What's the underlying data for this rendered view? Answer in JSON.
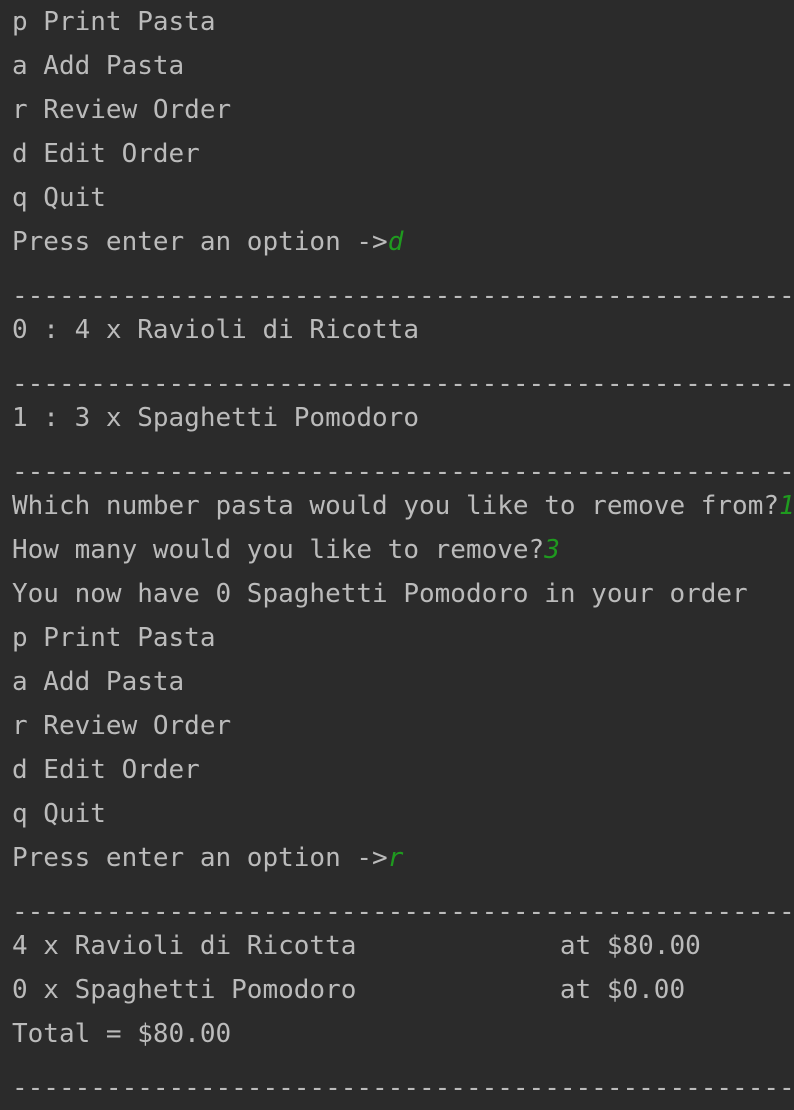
{
  "colors": {
    "background": "#2b2b2b",
    "text": "#bbbbbb",
    "user_input": "#1f9a1f"
  },
  "separator": "------------------------------------------------------------",
  "lines": [
    {
      "type": "text",
      "text": "p Print Pasta"
    },
    {
      "type": "text",
      "text": "a Add Pasta"
    },
    {
      "type": "text",
      "text": "r Review Order"
    },
    {
      "type": "text",
      "text": "d Edit Order"
    },
    {
      "type": "text",
      "text": "q Quit"
    },
    {
      "type": "prompt",
      "text": "Press enter an option ->",
      "input": "d"
    },
    {
      "type": "separator"
    },
    {
      "type": "text",
      "text": "0 : 4 x Ravioli di Ricotta"
    },
    {
      "type": "separator"
    },
    {
      "type": "text",
      "text": "1 : 3 x Spaghetti Pomodoro"
    },
    {
      "type": "separator"
    },
    {
      "type": "prompt",
      "text": "Which number pasta would you like to remove from?",
      "input": "1"
    },
    {
      "type": "prompt",
      "text": "How many would you like to remove?",
      "input": "3"
    },
    {
      "type": "text",
      "text": "You now have 0 Spaghetti Pomodoro in your order"
    },
    {
      "type": "text",
      "text": "p Print Pasta"
    },
    {
      "type": "text",
      "text": "a Add Pasta"
    },
    {
      "type": "text",
      "text": "r Review Order"
    },
    {
      "type": "text",
      "text": "d Edit Order"
    },
    {
      "type": "text",
      "text": "q Quit"
    },
    {
      "type": "prompt",
      "text": "Press enter an option ->",
      "input": "r"
    },
    {
      "type": "separator"
    },
    {
      "type": "text",
      "text": "4 x Ravioli di Ricotta             at $80.00"
    },
    {
      "type": "text",
      "text": "0 x Spaghetti Pomodoro             at $0.00"
    },
    {
      "type": "text",
      "text": "Total = $80.00"
    },
    {
      "type": "separator"
    }
  ]
}
